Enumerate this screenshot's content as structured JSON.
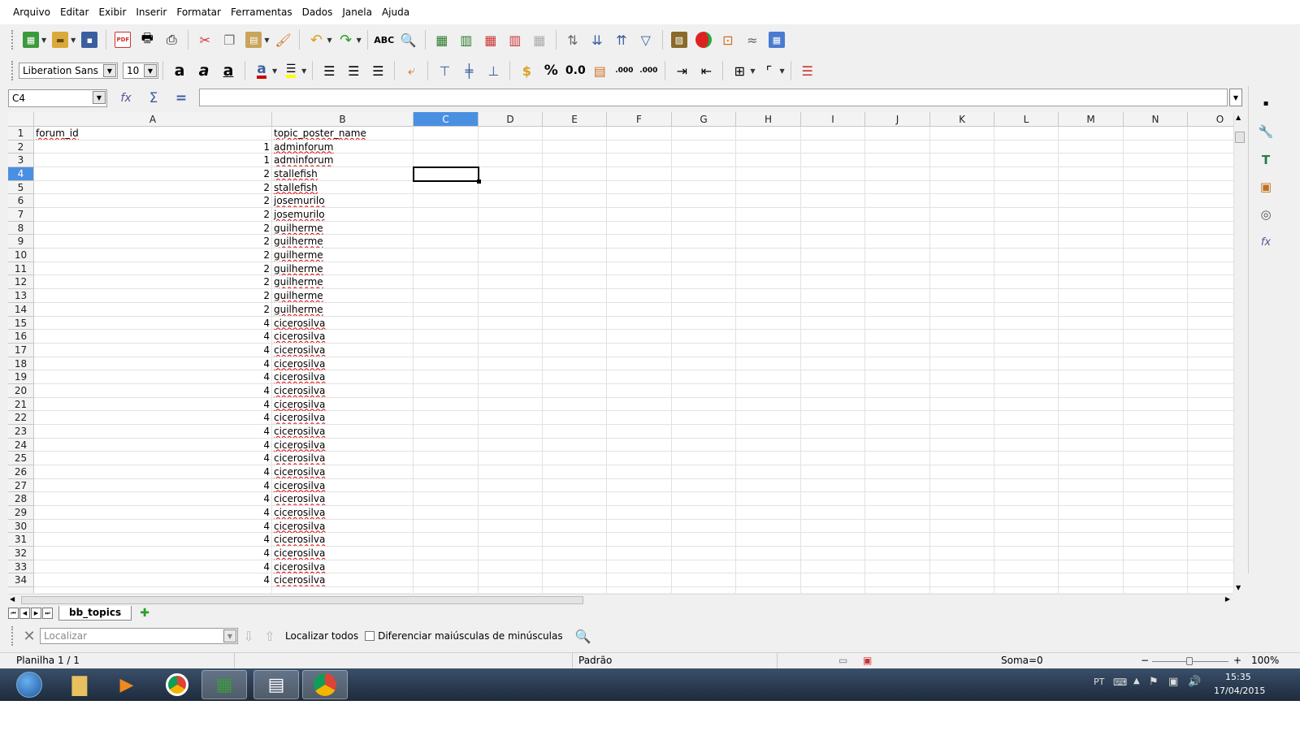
{
  "menu": {
    "file": "Arquivo",
    "edit": "Editar",
    "view": "Exibir",
    "insert": "Inserir",
    "format": "Formatar",
    "tools": "Ferramentas",
    "data": "Dados",
    "window": "Janela",
    "help": "Ajuda"
  },
  "formatting": {
    "font_name": "Liberation Sans",
    "font_size": "10",
    "percent": "%",
    "number": "0.0",
    "decimal_add": ".000",
    "decimal_del": ".000"
  },
  "formula_bar": {
    "cell_ref": "C4",
    "content": ""
  },
  "columns": [
    "A",
    "B",
    "C",
    "D",
    "E",
    "F",
    "G",
    "H",
    "I",
    "J",
    "K",
    "L",
    "M",
    "N",
    "O"
  ],
  "selected_column": "C",
  "selected_row": "4",
  "rows": [
    {
      "n": "1",
      "a": "forum_id",
      "b": "topic_poster_name"
    },
    {
      "n": "2",
      "a": "1",
      "b": "adminforum"
    },
    {
      "n": "3",
      "a": "1",
      "b": "adminforum"
    },
    {
      "n": "4",
      "a": "2",
      "b": "stallefish"
    },
    {
      "n": "5",
      "a": "2",
      "b": "stallefish"
    },
    {
      "n": "6",
      "a": "2",
      "b": "josemurilo"
    },
    {
      "n": "7",
      "a": "2",
      "b": "josemurilo"
    },
    {
      "n": "8",
      "a": "2",
      "b": "guilherme"
    },
    {
      "n": "9",
      "a": "2",
      "b": "guilherme"
    },
    {
      "n": "10",
      "a": "2",
      "b": "guilherme"
    },
    {
      "n": "11",
      "a": "2",
      "b": "guilherme"
    },
    {
      "n": "12",
      "a": "2",
      "b": "guilherme"
    },
    {
      "n": "13",
      "a": "2",
      "b": "guilherme"
    },
    {
      "n": "14",
      "a": "2",
      "b": "guilherme"
    },
    {
      "n": "15",
      "a": "4",
      "b": "cicerosilva"
    },
    {
      "n": "16",
      "a": "4",
      "b": "cicerosilva"
    },
    {
      "n": "17",
      "a": "4",
      "b": "cicerosilva"
    },
    {
      "n": "18",
      "a": "4",
      "b": "cicerosilva"
    },
    {
      "n": "19",
      "a": "4",
      "b": "cicerosilva"
    },
    {
      "n": "20",
      "a": "4",
      "b": "cicerosilva"
    },
    {
      "n": "21",
      "a": "4",
      "b": "cicerosilva"
    },
    {
      "n": "22",
      "a": "4",
      "b": "cicerosilva"
    },
    {
      "n": "23",
      "a": "4",
      "b": "cicerosilva"
    },
    {
      "n": "24",
      "a": "4",
      "b": "cicerosilva"
    },
    {
      "n": "25",
      "a": "4",
      "b": "cicerosilva"
    },
    {
      "n": "26",
      "a": "4",
      "b": "cicerosilva"
    },
    {
      "n": "27",
      "a": "4",
      "b": "cicerosilva"
    },
    {
      "n": "28",
      "a": "4",
      "b": "cicerosilva"
    },
    {
      "n": "29",
      "a": "4",
      "b": "cicerosilva"
    },
    {
      "n": "30",
      "a": "4",
      "b": "cicerosilva"
    },
    {
      "n": "31",
      "a": "4",
      "b": "cicerosilva"
    },
    {
      "n": "32",
      "a": "4",
      "b": "cicerosilva"
    },
    {
      "n": "33",
      "a": "4",
      "b": "cicerosilva"
    },
    {
      "n": "34",
      "a": "4",
      "b": "cicerosilva"
    }
  ],
  "sheet_tabs": [
    "bb_topics"
  ],
  "find": {
    "placeholder": "Localizar",
    "find_all": "Localizar todos",
    "match_case": "Diferenciar maiúsculas de minúsculas"
  },
  "status": {
    "sheet": "Planilha 1 / 1",
    "style": "Padrão",
    "sum": "Soma=0",
    "zoom": "100%"
  },
  "taskbar": {
    "lang": "PT",
    "time": "15:35",
    "date": "17/04/2015"
  }
}
